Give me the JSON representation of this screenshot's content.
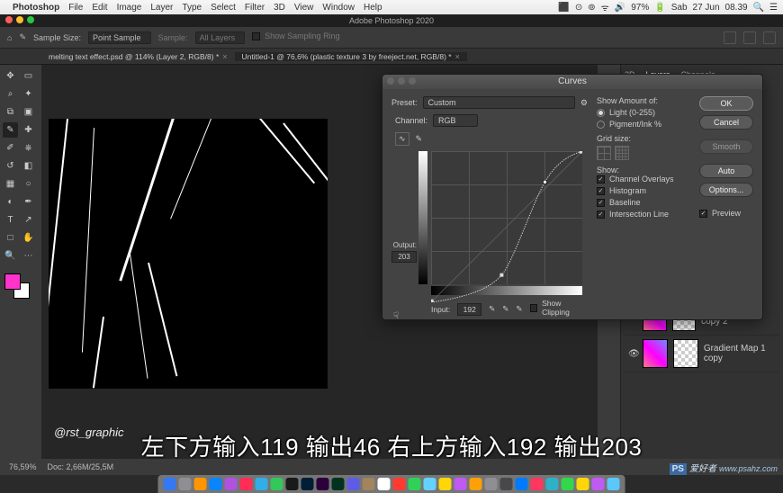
{
  "macmenu": {
    "app": "Photoshop",
    "items": [
      "File",
      "Edit",
      "Image",
      "Layer",
      "Type",
      "Select",
      "Filter",
      "3D",
      "View",
      "Window",
      "Help"
    ],
    "right": {
      "battery": "97%",
      "day": "Sab",
      "date": "27 Jun",
      "time": "08.39"
    }
  },
  "apptitle": "Adobe Photoshop 2020",
  "optbar": {
    "sample_size_label": "Sample Size:",
    "sample_size_value": "Point Sample",
    "sample_label": "Sample:",
    "sample_value": "All Layers",
    "show_ring": "Show Sampling Ring"
  },
  "tabs": [
    "melting text effect.psd @ 114% (Layer 2, RGB/8) *",
    "Untitled-1 @ 76,6% (plastic texture 3 by freeject.net, RGB/8) *"
  ],
  "rightpanel": {
    "tabs": [
      "3D",
      "Layers",
      "Channels"
    ]
  },
  "layers": [
    {
      "name": "Gradient Map 1 copy 2"
    },
    {
      "name": "Gradient Map 1 copy"
    }
  ],
  "status": {
    "zoom": "76,59%",
    "doc": "Doc: 2,66M/25,5M"
  },
  "dialog": {
    "title": "Curves",
    "preset_label": "Preset:",
    "preset_value": "Custom",
    "channel_label": "Channel:",
    "channel_value": "RGB",
    "output_label": "Output:",
    "output_value": "203",
    "input_label": "Input:",
    "input_value": "192",
    "show_clipping": "Show Clipping",
    "right": {
      "show_amount": "Show Amount of:",
      "light": "Light (0-255)",
      "pigment": "Pigment/Ink %",
      "grid": "Grid size:",
      "show": "Show:",
      "checks": [
        "Channel Overlays",
        "Histogram",
        "Baseline",
        "Intersection Line"
      ],
      "ok": "OK",
      "cancel": "Cancel",
      "smooth": "Smooth",
      "auto": "Auto",
      "options": "Options...",
      "preview": "Preview"
    }
  },
  "chart_data": {
    "type": "line",
    "title": "Curves",
    "xlabel": "Input",
    "ylabel": "Output",
    "xlim": [
      0,
      255
    ],
    "ylim": [
      0,
      255
    ],
    "series": [
      {
        "name": "RGB",
        "points": [
          {
            "x": 0,
            "y": 0
          },
          {
            "x": 119,
            "y": 46
          },
          {
            "x": 192,
            "y": 203
          },
          {
            "x": 255,
            "y": 255
          }
        ]
      }
    ]
  },
  "credit": "@rst_graphic",
  "subtitle": "左下方输入119 输出46 右上方输入192 输出203",
  "watermark": {
    "ps": "PS",
    "txt": "爱好者",
    "url": "www.psahz.com"
  },
  "dock_colors": [
    "#3478f6",
    "#8e8e93",
    "#ff9500",
    "#0a84ff",
    "#af52de",
    "#ff2d55",
    "#32ade6",
    "#34c759",
    "#1a1a1a",
    "#001e36",
    "#2b003b",
    "#013220",
    "#5e5ce6",
    "#a2845e",
    "#ffffff",
    "#ff3b30",
    "#30d158",
    "#64d2ff",
    "#ffd60a",
    "#bf5af2",
    "#ff9f0a",
    "#8e8e93",
    "#48484a",
    "#007aff",
    "#ff375f",
    "#30b0c7",
    "#32d74b",
    "#ffd60a",
    "#bf5af2",
    "#5ac8fa"
  ]
}
